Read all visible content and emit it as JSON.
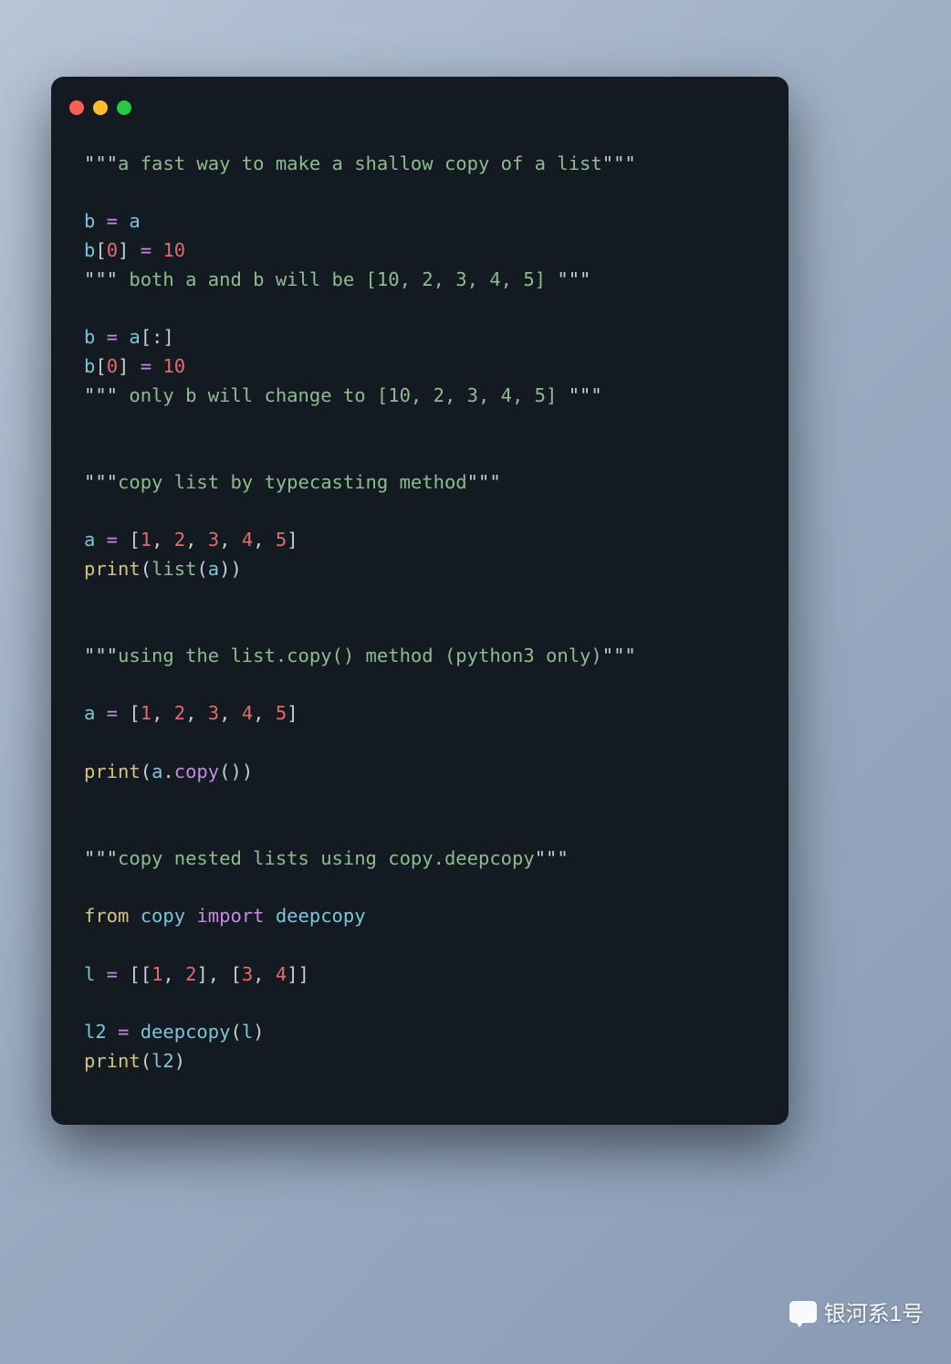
{
  "window": {
    "traffic_lights": [
      "close",
      "minimize",
      "zoom"
    ]
  },
  "code": {
    "line1": {
      "q": "\"\"\"",
      "txt": "a fast way to make a shallow copy of a list",
      "q2": "\"\"\""
    },
    "line2": "",
    "line3": {
      "a": "b",
      "eq": " = ",
      "b": "a"
    },
    "line4": {
      "a": "b",
      "lb": "[",
      "n": "0",
      "rb": "]",
      "eq": " = ",
      "val": "10"
    },
    "line5": {
      "q": "\"\"\"",
      "txt": " both a and b will be [10, 2, 3, 4, 5] ",
      "q2": "\"\"\""
    },
    "line6": "",
    "line7": {
      "a": "b",
      "eq": " = ",
      "b": "a",
      "sl": "[:]"
    },
    "line8": {
      "a": "b",
      "lb": "[",
      "n": "0",
      "rb": "]",
      "eq": " = ",
      "val": "10"
    },
    "line9": {
      "q": "\"\"\"",
      "txt": " only b will change to [10, 2, 3, 4, 5] ",
      "q2": "\"\"\""
    },
    "line10": "",
    "line11": "",
    "line12": {
      "q": "\"\"\"",
      "txt": "copy list by typecasting method",
      "q2": "\"\"\""
    },
    "line13": "",
    "line14": {
      "a": "a",
      "eq": " = ",
      "lb": "[",
      "n1": "1",
      "c1": ", ",
      "n2": "2",
      "c2": ", ",
      "n3": "3",
      "c3": ", ",
      "n4": "4",
      "c4": ", ",
      "n5": "5",
      "rb": "]"
    },
    "line15": {
      "fn": "print",
      "lp": "(",
      "bi": "list",
      "lp2": "(",
      "arg": "a",
      "rp2": ")",
      "rp": ")"
    },
    "line16": "",
    "line17": "",
    "line18": {
      "q": "\"\"\"",
      "txt": "using the list.copy() method (python3 only)",
      "q2": "\"\"\""
    },
    "line19": "",
    "line20": {
      "a": "a",
      "eq": " = ",
      "lb": "[",
      "n1": "1",
      "c1": ", ",
      "n2": "2",
      "c2": ", ",
      "n3": "3",
      "c3": ", ",
      "n4": "4",
      "c4": ", ",
      "n5": "5",
      "rb": "]"
    },
    "line21": "",
    "line22": {
      "fn": "print",
      "lp": "(",
      "obj": "a",
      "dot": ".",
      "method": "copy",
      "lp2": "(",
      "rp2": ")",
      "rp": ")"
    },
    "line23": "",
    "line24": "",
    "line25": {
      "q": "\"\"\"",
      "txt": "copy nested lists using copy.deepcopy",
      "q2": "\"\"\""
    },
    "line26": "",
    "line27": {
      "from": "from",
      "sp1": " ",
      "mod": "copy",
      "sp2": " ",
      "imp": "import",
      "sp3": " ",
      "name": "deepcopy"
    },
    "line28": "",
    "line29": {
      "a": "l",
      "eq": " = ",
      "lb": "[",
      "lb2": "[",
      "n1": "1",
      "c1": ", ",
      "n2": "2",
      "rb2": "]",
      "c2": ", ",
      "lb3": "[",
      "n3": "3",
      "c3": ", ",
      "n4": "4",
      "rb3": "]",
      "rb": "]"
    },
    "line30": "",
    "line31": {
      "a": "l2",
      "eq": " = ",
      "fn": "deepcopy",
      "lp": "(",
      "arg": "l",
      "rp": ")"
    },
    "line32": {
      "fn": "print",
      "lp": "(",
      "arg": "l2",
      "rp": ")"
    }
  },
  "watermark": {
    "text": "银河系1号"
  }
}
